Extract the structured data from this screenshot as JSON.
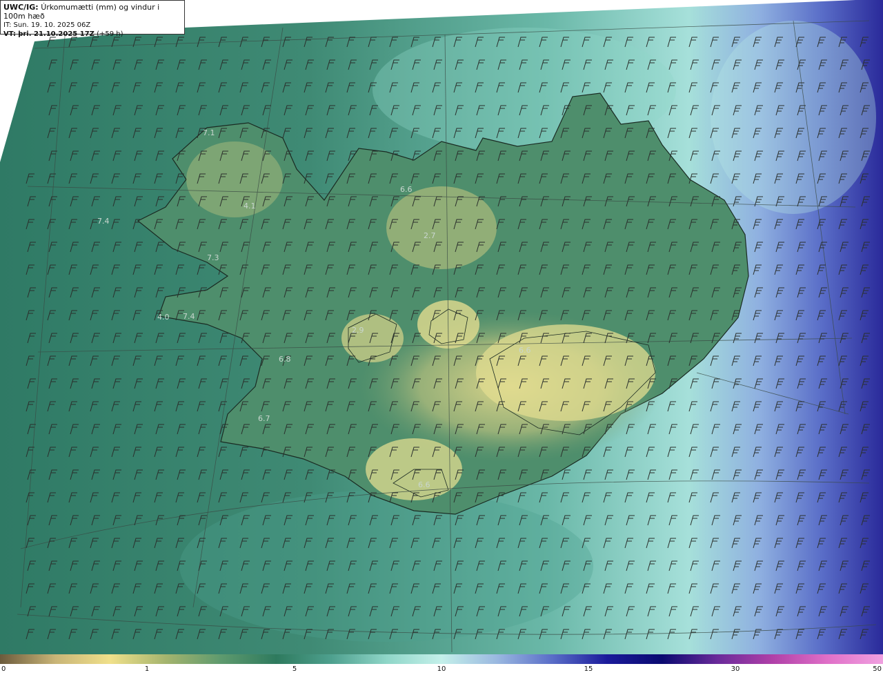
{
  "header": {
    "model": "UWC/IG:",
    "product": "Úrkomumætti (mm) og vindur i 100m hæð",
    "init_time": "IT: Sun. 19. 10. 2025 06Z",
    "valid_label": "VT:",
    "valid_time": "þri. 21.10.2025 17Z",
    "lead": "(+59 h)"
  },
  "station_values": [
    {
      "name": "s1",
      "value": "7.1"
    },
    {
      "name": "s2",
      "value": "4.1"
    },
    {
      "name": "s3",
      "value": "7.4"
    },
    {
      "name": "s4",
      "value": "7.3"
    },
    {
      "name": "s5",
      "value": "4.0"
    },
    {
      "name": "s6",
      "value": "7.4"
    },
    {
      "name": "s7",
      "value": "6.8"
    },
    {
      "name": "s8",
      "value": "6.7"
    },
    {
      "name": "s9",
      "value": "2.7"
    },
    {
      "name": "s10",
      "value": "2.9"
    },
    {
      "name": "s11",
      "value": "6.6"
    },
    {
      "name": "s12",
      "value": "6.6"
    },
    {
      "name": "s13",
      "value": "6.6"
    }
  ],
  "colorbar": {
    "ticks": [
      "0",
      "1",
      "5",
      "10",
      "15",
      "30",
      "50"
    ],
    "colors": [
      "#6b5a3c",
      "#c9b577",
      "#f0e08a",
      "#a4b46e",
      "#5e9a6e",
      "#2e7a5e",
      "#4ea08e",
      "#8fd6c8",
      "#c4f0ea",
      "#9ab8e0",
      "#5a6ec8",
      "#1a1a9a",
      "#0a0a70",
      "#6a2a9a",
      "#b040a8",
      "#e070c8",
      "#f0a0e0"
    ]
  },
  "map_colors": {
    "deep_sea": "#2f7a65",
    "mid_sea": "#5aa898",
    "light_sea": "#a8e2da",
    "east_blue": "#7f98d8",
    "far_east": "#2a2a9a",
    "land_low": "#4f8f6a",
    "land_high": "#d8d48a"
  }
}
